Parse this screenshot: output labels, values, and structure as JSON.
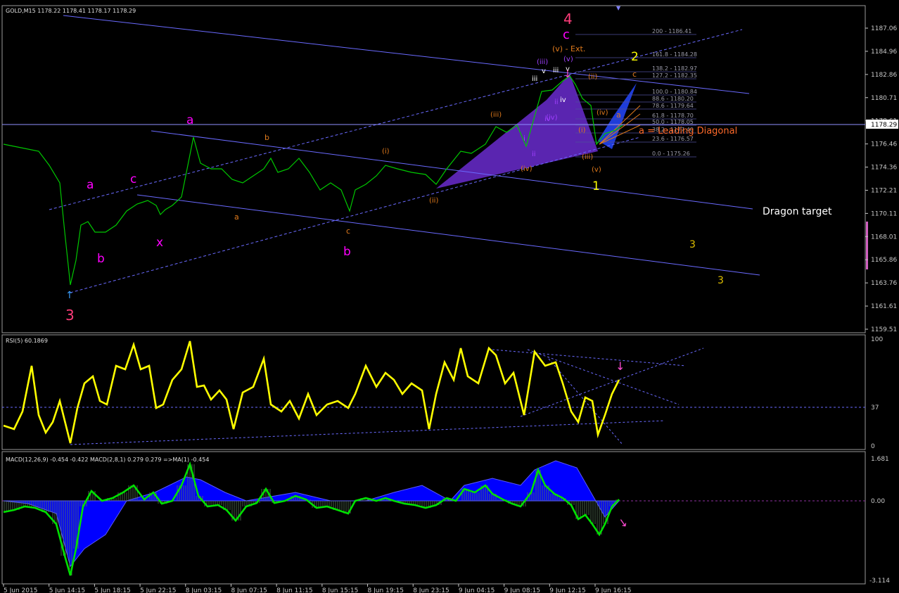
{
  "main": {
    "title": "GOLD,M15  1178.22 1178.41 1178.17 1178.29",
    "price_ticks": [
      "1187.06",
      "1184.96",
      "1182.86",
      "1180.71",
      "1178.61",
      "1176.46",
      "1174.36",
      "1172.21",
      "1170.11",
      "1168.01",
      "1165.86",
      "1163.76",
      "1161.61",
      "1159.51"
    ],
    "current_price": "1178.29",
    "dragon_target": "Dragon target",
    "leading_diagonal": "a = Leading Diagonal",
    "extension": "(v) - Ext."
  },
  "fib": [
    "200 - 1186.41",
    "161.8 - 1184.28",
    "138.2 - 1182.97",
    "127.2 - 1182.35",
    "100.0 - 1180.84",
    "88.6 - 1180.20",
    "78.6 - 1179.64",
    "61.8 - 1178.70",
    "50.0 - 1178.05",
    "38.2 - 1177.40",
    "23.6 - 1176.57",
    "0.0 - 1175.26"
  ],
  "labels": {
    "magenta": [
      "a",
      "c",
      "b",
      "x",
      "a",
      "b",
      "3",
      "4",
      "c"
    ],
    "orange_small": [
      "b",
      "a",
      "c",
      "(i)",
      "(ii)",
      "(iii)",
      "(iv)",
      "(i)",
      "(ii)",
      "(iii)",
      "(iv)",
      "(v)",
      "c",
      "a",
      "(v)"
    ],
    "purple_small": [
      "(iii)",
      "(v)",
      "iii",
      "v",
      "iv",
      "(iv)",
      "ii",
      "iii",
      "iv",
      "v",
      "i",
      "ii"
    ],
    "yellow": [
      "1",
      "2",
      "3",
      "3"
    ]
  },
  "rsi": {
    "title": "RSI(5) 60.1869",
    "ticks": [
      "100",
      "37",
      "0"
    ]
  },
  "macd": {
    "title": "MACD(12,26,9) -0.454 -0.422  MACD(2,8,1) 0.279 0.279  =>MA(1) -0.454",
    "ticks": [
      "1.681",
      "0.00",
      "-3.114"
    ]
  },
  "time_axis": [
    "5 Jun 2015",
    "5 Jun 14:15",
    "5 Jun 18:15",
    "5 Jun 22:15",
    "8 Jun 03:15",
    "8 Jun 07:15",
    "8 Jun 11:15",
    "8 Jun 15:15",
    "8 Jun 19:15",
    "8 Jun 23:15",
    "9 Jun 04:15",
    "9 Jun 08:15",
    "9 Jun 12:15",
    "9 Jun 16:15"
  ],
  "colors": {
    "candle": "#00c800",
    "rsi": "#ffff00",
    "macd_line": "#00e000",
    "macd_hist": "#0000ff",
    "channel": "#6a6aff",
    "wave_magenta": "#ff00ff",
    "wave_red": "#ff3c7a",
    "fib_text": "#9a9aa8",
    "pattern_fill": "#6a2ccf",
    "orange": "#e07a1c",
    "yellow": "#ffff00"
  },
  "chart_data": {
    "type": "line",
    "symbol": "GOLD",
    "timeframe": "M15",
    "x": [
      "5 Jun 2015",
      "5 Jun 14:15",
      "5 Jun 18:15",
      "5 Jun 22:15",
      "8 Jun 03:15",
      "8 Jun 07:15",
      "8 Jun 11:15",
      "8 Jun 15:15",
      "8 Jun 19:15",
      "8 Jun 23:15",
      "9 Jun 04:15",
      "9 Jun 08:15",
      "9 Jun 12:15",
      "9 Jun 16:15"
    ],
    "series": [
      {
        "name": "GOLD,M15",
        "values": [
          1177.2,
          1163.4,
          1168.5,
          1170.4,
          1175.8,
          1172.5,
          1174.7,
          1170.5,
          1174.0,
          1172.6,
          1176.5,
          1180.8,
          1182.3,
          1178.3
        ]
      },
      {
        "name": "RSI(5)",
        "values": [
          15,
          42,
          35,
          58,
          70,
          45,
          53,
          30,
          56,
          30,
          80,
          48,
          66,
          60
        ]
      },
      {
        "name": "MACD(12,26,9)",
        "values": [
          -0.2,
          -2.8,
          -0.3,
          0.2,
          1.3,
          0.1,
          0.2,
          -0.2,
          0.1,
          -0.1,
          0.5,
          0.6,
          0.9,
          -0.454
        ]
      }
    ],
    "ylim": [
      1159.51,
      1187.06
    ]
  }
}
